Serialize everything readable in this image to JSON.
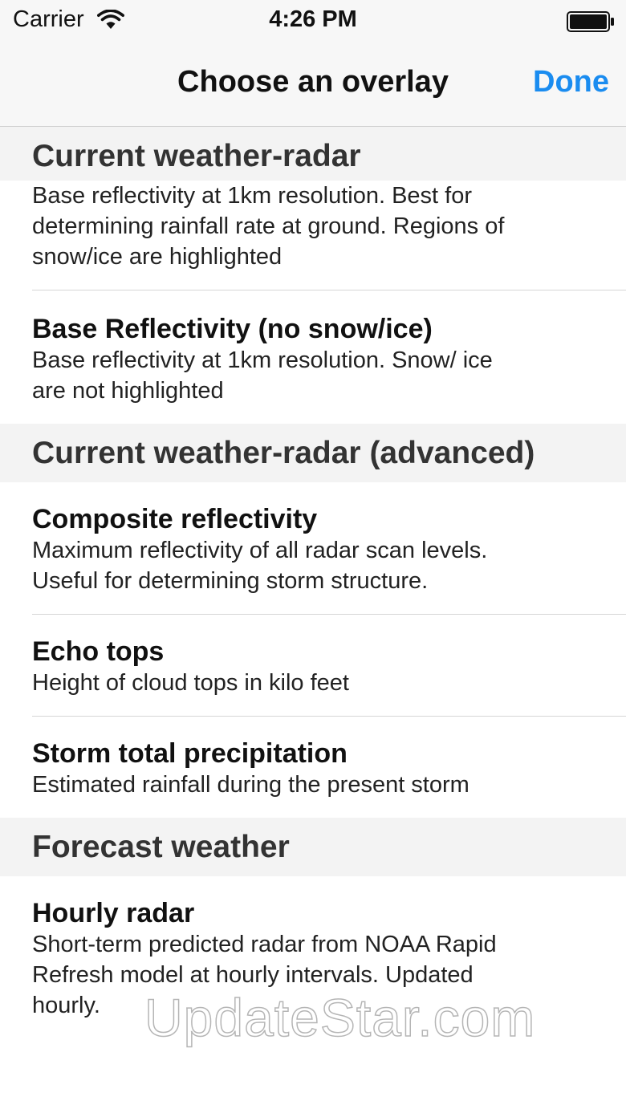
{
  "status_bar": {
    "carrier": "Carrier",
    "time": "4:26 PM",
    "icons": [
      "wifi-icon",
      "battery-icon"
    ]
  },
  "nav": {
    "title": "Choose an overlay",
    "done_label": "Done",
    "accent_color": "#1a8cf0"
  },
  "sections": [
    {
      "header": "Current weather-radar",
      "items": [
        {
          "title": "",
          "subtitle": "Base reflectivity at 1km resolution. Best for determining rainfall rate at ground. Regions of snow/ice are highlighted"
        },
        {
          "title": "Base Reflectivity (no snow/ice)",
          "subtitle": "Base reflectivity at 1km resolution. Snow/ ice are not highlighted"
        }
      ]
    },
    {
      "header": "Current weather-radar (advanced)",
      "items": [
        {
          "title": "Composite reflectivity",
          "subtitle": "Maximum reflectivity of all radar scan levels. Useful for determining storm structure."
        },
        {
          "title": "Echo tops",
          "subtitle": "Height of cloud tops in kilo feet"
        },
        {
          "title": "Storm total precipitation",
          "subtitle": "Estimated rainfall during the present storm"
        }
      ]
    },
    {
      "header": "Forecast weather",
      "items": [
        {
          "title": "Hourly radar",
          "subtitle": "Short-term predicted radar from NOAA Rapid Refresh model at hourly intervals. Updated hourly."
        }
      ]
    }
  ],
  "watermark": "UpdateStar.com"
}
